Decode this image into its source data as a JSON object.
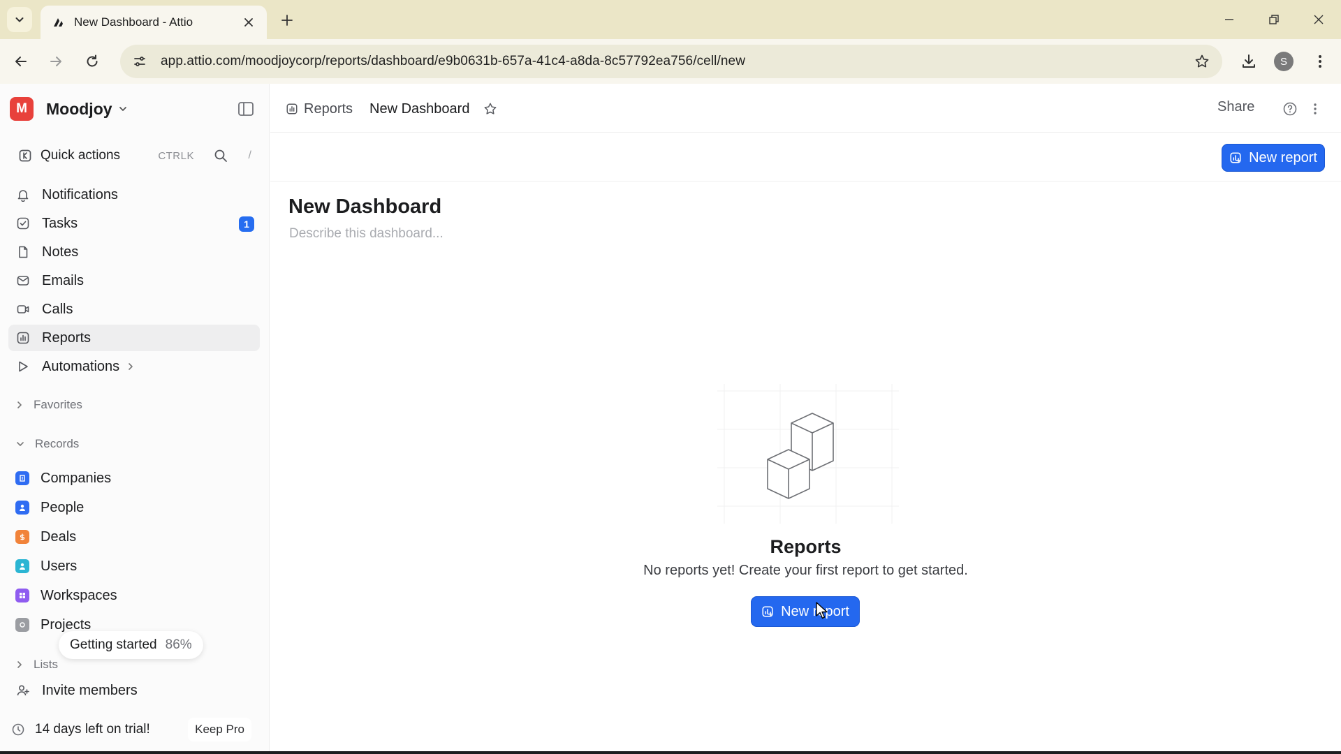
{
  "browser": {
    "tab_title": "New Dashboard - Attio",
    "url": "app.attio.com/moodjoycorp/reports/dashboard/e9b0631b-657a-41c4-a8da-8c57792ea756/cell/new",
    "profile_initial": "S"
  },
  "sidebar": {
    "workspace_initial": "M",
    "workspace_name": "Moodjoy",
    "quick_actions": {
      "label": "Quick actions",
      "shortcut": "CTRLK",
      "search_shortcut": "/"
    },
    "nav": [
      {
        "label": "Notifications",
        "icon": "bell-icon"
      },
      {
        "label": "Tasks",
        "icon": "checkbox-icon",
        "badge": "1"
      },
      {
        "label": "Notes",
        "icon": "note-icon"
      },
      {
        "label": "Emails",
        "icon": "mail-icon"
      },
      {
        "label": "Calls",
        "icon": "video-icon"
      },
      {
        "label": "Reports",
        "icon": "chart-icon",
        "active": true
      },
      {
        "label": "Automations",
        "icon": "play-icon"
      }
    ],
    "favorites_label": "Favorites",
    "records_label": "Records",
    "records": [
      {
        "label": "Companies",
        "color": "#2f6cf2"
      },
      {
        "label": "People",
        "color": "#2f6cf2"
      },
      {
        "label": "Deals",
        "color": "#f1833a"
      },
      {
        "label": "Users",
        "color": "#2bb5d3"
      },
      {
        "label": "Workspaces",
        "color": "#8f5cf0"
      },
      {
        "label": "Projects",
        "color": "#9b9da2"
      }
    ],
    "getting_started": {
      "label": "Getting started",
      "percent": "86%"
    },
    "lists_label": "Lists",
    "invite_label": "Invite members",
    "trial_label": "14 days left on trial!",
    "keep_pro_label": "Keep Pro"
  },
  "main": {
    "breadcrumb_parent": "Reports",
    "breadcrumb_current": "New Dashboard",
    "share_label": "Share",
    "new_report_label": "New report",
    "dashboard_title": "New Dashboard",
    "description_placeholder": "Describe this dashboard...",
    "empty_title": "Reports",
    "empty_subtitle": "No reports yet! Create your first report to get started.",
    "empty_button_label": "New report"
  },
  "colors": {
    "accent": "#2468ef",
    "workspace_logo": "#e8413b",
    "chrome": "#ebe6c7"
  }
}
